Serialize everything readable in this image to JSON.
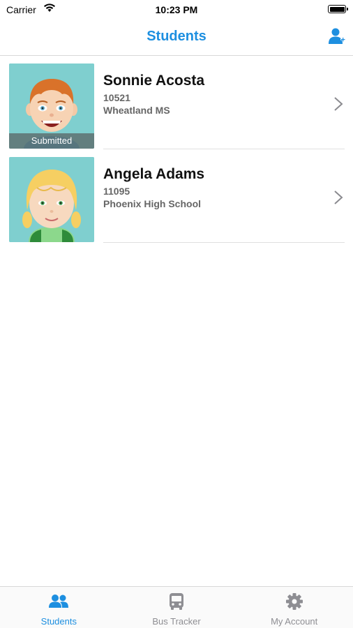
{
  "status_bar": {
    "carrier": "Carrier",
    "time": "10:23 PM"
  },
  "header": {
    "title": "Students",
    "add_icon": "add-student-icon"
  },
  "students": [
    {
      "name": "Sonnie Acosta",
      "id": "10521",
      "school": "Wheatland MS",
      "badge": "Submitted"
    },
    {
      "name": "Angela Adams",
      "id": "11095",
      "school": "Phoenix High School",
      "badge": ""
    }
  ],
  "tabs": [
    {
      "label": "Students",
      "icon": "people-icon",
      "active": true
    },
    {
      "label": "Bus Tracker",
      "icon": "bus-icon",
      "active": false
    },
    {
      "label": "My Account",
      "icon": "gear-icon",
      "active": false
    }
  ],
  "colors": {
    "accent": "#1d8fe0",
    "avatar_bg": "#7fcfcf",
    "inactive_tab": "#8e8e93"
  }
}
